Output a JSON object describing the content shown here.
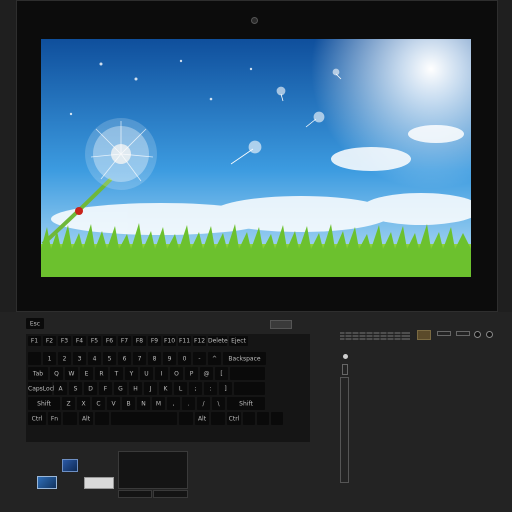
{
  "keyboard": {
    "esc_label": "Esc",
    "rows": [
      [
        {
          "label": "F1",
          "w": 15
        },
        {
          "label": "F2",
          "w": 15
        },
        {
          "label": "F3",
          "w": 15
        },
        {
          "label": "F4",
          "w": 15
        },
        {
          "label": "F5",
          "w": 15
        },
        {
          "label": "F6",
          "w": 15
        },
        {
          "label": "F7",
          "w": 15
        },
        {
          "label": "F8",
          "w": 15
        },
        {
          "label": "F9",
          "w": 15
        },
        {
          "label": "F10",
          "w": 15
        },
        {
          "label": "F11",
          "w": 15
        },
        {
          "label": "F12",
          "w": 15
        },
        {
          "label": "Delete",
          "w": 21
        },
        {
          "label": "Eject",
          "w": 21
        }
      ],
      [
        {
          "label": "",
          "w": 15
        },
        {
          "label": "1",
          "w": 15
        },
        {
          "label": "2",
          "w": 15
        },
        {
          "label": "3",
          "w": 15
        },
        {
          "label": "4",
          "w": 15
        },
        {
          "label": "5",
          "w": 15
        },
        {
          "label": "6",
          "w": 15
        },
        {
          "label": "7",
          "w": 15
        },
        {
          "label": "8",
          "w": 15
        },
        {
          "label": "9",
          "w": 15
        },
        {
          "label": "0",
          "w": 15
        },
        {
          "label": "-",
          "w": 15
        },
        {
          "label": "^",
          "w": 15
        },
        {
          "label": "Backspace",
          "w": 45
        }
      ],
      [
        {
          "label": "Tab",
          "w": 22
        },
        {
          "label": "Q",
          "w": 15
        },
        {
          "label": "W",
          "w": 15
        },
        {
          "label": "E",
          "w": 15
        },
        {
          "label": "R",
          "w": 15
        },
        {
          "label": "T",
          "w": 15
        },
        {
          "label": "Y",
          "w": 15
        },
        {
          "label": "U",
          "w": 15
        },
        {
          "label": "I",
          "w": 15
        },
        {
          "label": "O",
          "w": 15
        },
        {
          "label": "P",
          "w": 15
        },
        {
          "label": "@",
          "w": 15
        },
        {
          "label": "[",
          "w": 15
        },
        {
          "label": "",
          "w": 37
        }
      ],
      [
        {
          "label": "CapsLock",
          "w": 26
        },
        {
          "label": "A",
          "w": 15
        },
        {
          "label": "S",
          "w": 15
        },
        {
          "label": "D",
          "w": 15
        },
        {
          "label": "F",
          "w": 15
        },
        {
          "label": "G",
          "w": 15
        },
        {
          "label": "H",
          "w": 15
        },
        {
          "label": "J",
          "w": 15
        },
        {
          "label": "K",
          "w": 15
        },
        {
          "label": "L",
          "w": 15
        },
        {
          "label": ";",
          "w": 15
        },
        {
          "label": ":",
          "w": 15
        },
        {
          "label": "]",
          "w": 15
        },
        {
          "label": "",
          "w": 33
        }
      ],
      [
        {
          "label": "Shift",
          "w": 34
        },
        {
          "label": "Z",
          "w": 15
        },
        {
          "label": "X",
          "w": 15
        },
        {
          "label": "C",
          "w": 15
        },
        {
          "label": "V",
          "w": 15
        },
        {
          "label": "B",
          "w": 15
        },
        {
          "label": "N",
          "w": 15
        },
        {
          "label": "M",
          "w": 15
        },
        {
          "label": ",",
          "w": 15
        },
        {
          "label": ".",
          "w": 15
        },
        {
          "label": "/",
          "w": 15
        },
        {
          "label": "\\",
          "w": 15
        },
        {
          "label": "Shift",
          "w": 40
        }
      ],
      [
        {
          "label": "Ctrl",
          "w": 20
        },
        {
          "label": "Fn",
          "w": 15
        },
        {
          "label": "",
          "w": 16
        },
        {
          "label": "Alt",
          "w": 16
        },
        {
          "label": "",
          "w": 16
        },
        {
          "label": "",
          "w": 68
        },
        {
          "label": "",
          "w": 16
        },
        {
          "label": "Alt",
          "w": 16
        },
        {
          "label": "",
          "w": 16
        },
        {
          "label": "Ctrl",
          "w": 16
        },
        {
          "label": "",
          "w": 14
        },
        {
          "label": "",
          "w": 14
        },
        {
          "label": "",
          "w": 14
        }
      ]
    ]
  },
  "colors": {
    "body": "#1f1f1f",
    "bezel": "#0c0c0c",
    "key": "#0a0a0a",
    "key_label": "#bdbdbd"
  },
  "screen": {
    "wallpaper": "dandelion-meadow-sky"
  },
  "icons": {
    "webcam": "webcam-icon",
    "windows_key": "windows-logo-icon",
    "intel": "intel-sticker-icon",
    "windows": "windows-sticker-icon"
  }
}
